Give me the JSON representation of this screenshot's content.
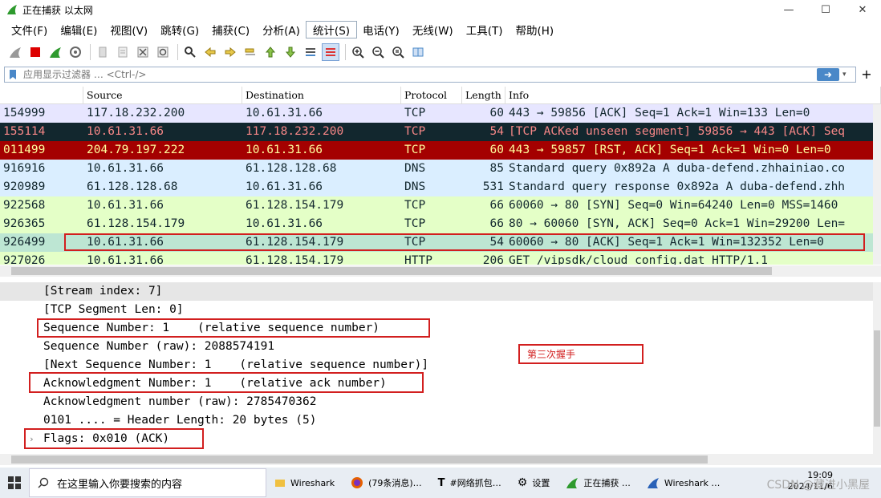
{
  "window": {
    "title": "正在捕获 以太网",
    "controls": [
      "—",
      "☐",
      "✕"
    ]
  },
  "menu": [
    "文件(F)",
    "编辑(E)",
    "视图(V)",
    "跳转(G)",
    "捕获(C)",
    "分析(A)",
    "统计(S)",
    "电话(Y)",
    "无线(W)",
    "工具(T)",
    "帮助(H)"
  ],
  "filter": {
    "placeholder": "应用显示过滤器 … <Ctrl-/>",
    "apply_icon": "arrow-right-icon",
    "dropdown_icon": "▾",
    "add_label": "+"
  },
  "packet_list": {
    "columns": [
      "",
      "Source",
      "Destination",
      "Protocol",
      "Length",
      "Info"
    ],
    "rows": [
      {
        "no": "154999",
        "src": "117.18.232.200",
        "dst": "10.61.31.66",
        "proto": "TCP",
        "len": "60",
        "info": "443 → 59856 [ACK] Seq=1 Ack=1 Win=133 Len=0",
        "bg": "#e7e6ff",
        "fg": "#12272e"
      },
      {
        "no": "155114",
        "src": "10.61.31.66",
        "dst": "117.18.232.200",
        "proto": "TCP",
        "len": "54",
        "info": "[TCP ACKed unseen segment] 59856 → 443 [ACK] Seq",
        "bg": "#12272e",
        "fg": "#f78787"
      },
      {
        "no": "011499",
        "src": "204.79.197.222",
        "dst": "10.61.31.66",
        "proto": "TCP",
        "len": "60",
        "info": "443 → 59857 [RST, ACK] Seq=1 Ack=1 Win=0 Len=0",
        "bg": "#a40000",
        "fg": "#fffc9c"
      },
      {
        "no": "916916",
        "src": "10.61.31.66",
        "dst": "61.128.128.68",
        "proto": "DNS",
        "len": "85",
        "info": "Standard query 0x892a A duba-defend.zhhainiao.co",
        "bg": "#daeeff",
        "fg": "#12272e"
      },
      {
        "no": "920989",
        "src": "61.128.128.68",
        "dst": "10.61.31.66",
        "proto": "DNS",
        "len": "531",
        "info": "Standard query response 0x892a A duba-defend.zhh",
        "bg": "#daeeff",
        "fg": "#12272e"
      },
      {
        "no": "922568",
        "src": "10.61.31.66",
        "dst": "61.128.154.179",
        "proto": "TCP",
        "len": "66",
        "info": "60060 → 80 [SYN] Seq=0 Win=64240 Len=0 MSS=1460",
        "bg": "#e4ffc7",
        "fg": "#12272e"
      },
      {
        "no": "926365",
        "src": "61.128.154.179",
        "dst": "10.61.31.66",
        "proto": "TCP",
        "len": "66",
        "info": "80 → 60060 [SYN, ACK] Seq=0 Ack=1 Win=29200 Len=",
        "bg": "#e4ffc7",
        "fg": "#12272e"
      },
      {
        "no": "926499",
        "src": "10.61.31.66",
        "dst": "61.128.154.179",
        "proto": "TCP",
        "len": "54",
        "info": "60060 → 80 [ACK] Seq=1 Ack=1 Win=132352 Len=0",
        "bg": "#bde6d3",
        "fg": "#12272e"
      },
      {
        "no": "927026",
        "src": "10.61.31.66",
        "dst": "61.128.154.179",
        "proto": "HTTP",
        "len": "206",
        "info": "GET /vipsdk/cloud_config.dat HTTP/1.1",
        "bg": "#e4ffc7",
        "fg": "#12272e"
      }
    ]
  },
  "details": [
    "[Stream index: 7]",
    "[TCP Segment Len: 0]",
    "Sequence Number: 1    (relative sequence number)",
    "Sequence Number (raw): 2088574191",
    "[Next Sequence Number: 1    (relative sequence number)]",
    "Acknowledgment Number: 1    (relative ack number)",
    "Acknowledgment number (raw): 2785470362",
    "0101 .... = Header Length: 20 bytes (5)",
    "Flags: 0x010 (ACK)"
  ],
  "annotation": "第三次握手",
  "taskbar": {
    "search_placeholder": "在这里输入你要搜索的内容",
    "items": [
      "Wireshark",
      "(79条消息)…",
      "#网络抓包…",
      "设置",
      "正在捕获 …",
      "Wireshark …"
    ],
    "clock_time": "19:09",
    "clock_date": "2024/11/6",
    "watermark": "CSDN @藏进小黑屋"
  },
  "colors": {
    "highlight_box": "#d21f1f"
  }
}
